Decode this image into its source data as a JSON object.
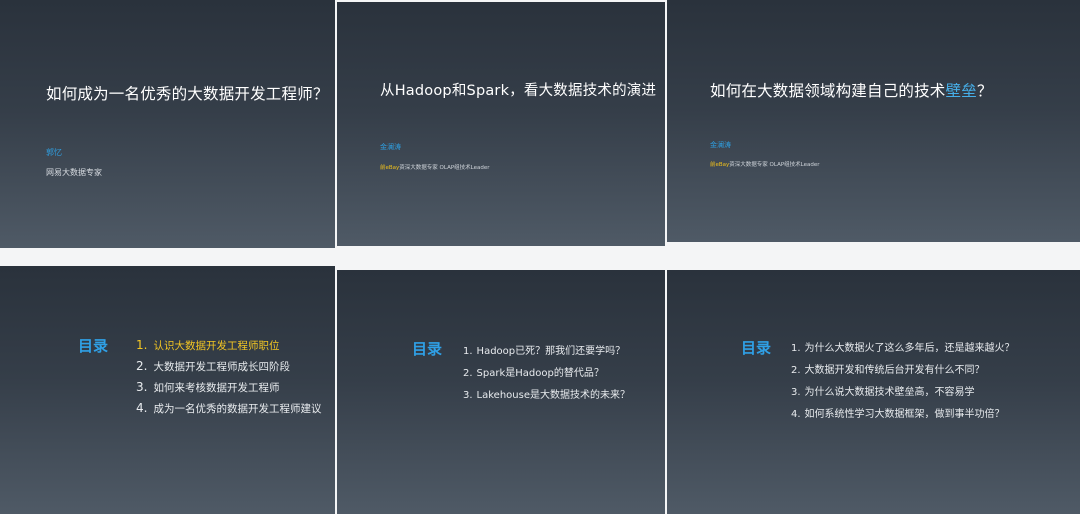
{
  "slides": [
    {
      "title": "如何成为一名优秀的大数据开发工程师？",
      "author": "郭忆",
      "desc": "网易大数据专家"
    },
    {
      "title": "从Hadoop和Spark，看大数据技术的演进",
      "author": "金澜涛",
      "desc_highlight": "前eBay",
      "desc_rest": "资深大数据专家 OLAP组技术Leader"
    },
    {
      "title_main": "如何在大数据领域构建自己的技术",
      "title_highlight": "壁垒",
      "title_end": "？",
      "author": "金澜涛",
      "desc_highlight": "前eBay",
      "desc_rest": "资深大数据专家 OLAP组技术Leader"
    }
  ],
  "tocs": [
    {
      "label": "目录",
      "items": [
        {
          "num": "1.",
          "text": "认识大数据开发工程师职位"
        },
        {
          "num": "2.",
          "text": "大数据开发工程师成长四阶段"
        },
        {
          "num": "3.",
          "text": "如何来考核数据开发工程师"
        },
        {
          "num": "4.",
          "text": "成为一名优秀的数据开发工程师建议"
        }
      ]
    },
    {
      "label": "目录",
      "items": [
        {
          "num": "1.",
          "text": "Hadoop已死？那我们还要学吗？"
        },
        {
          "num": "2.",
          "text": "Spark是Hadoop的替代品？"
        },
        {
          "num": "3.",
          "text": "Lakehouse是大数据技术的未来？"
        }
      ]
    },
    {
      "label": "目录",
      "items": [
        {
          "num": "1.",
          "text": "为什么大数据火了这么多年后，还是越来越火？"
        },
        {
          "num": "2.",
          "text": "大数据开发和传统后台开发有什么不同？"
        },
        {
          "num": "3.",
          "text": "为什么说大数据技术壁垒高，不容易学"
        },
        {
          "num": "4.",
          "text": "如何系统性学习大数据框架，做到事半功倍？"
        }
      ]
    }
  ],
  "colors": {
    "accent_blue": "#2f9ee0",
    "highlight_yellow": "#f3c623",
    "slide_bg_top": "#2a323c",
    "slide_bg_bottom": "#4f5a66"
  }
}
